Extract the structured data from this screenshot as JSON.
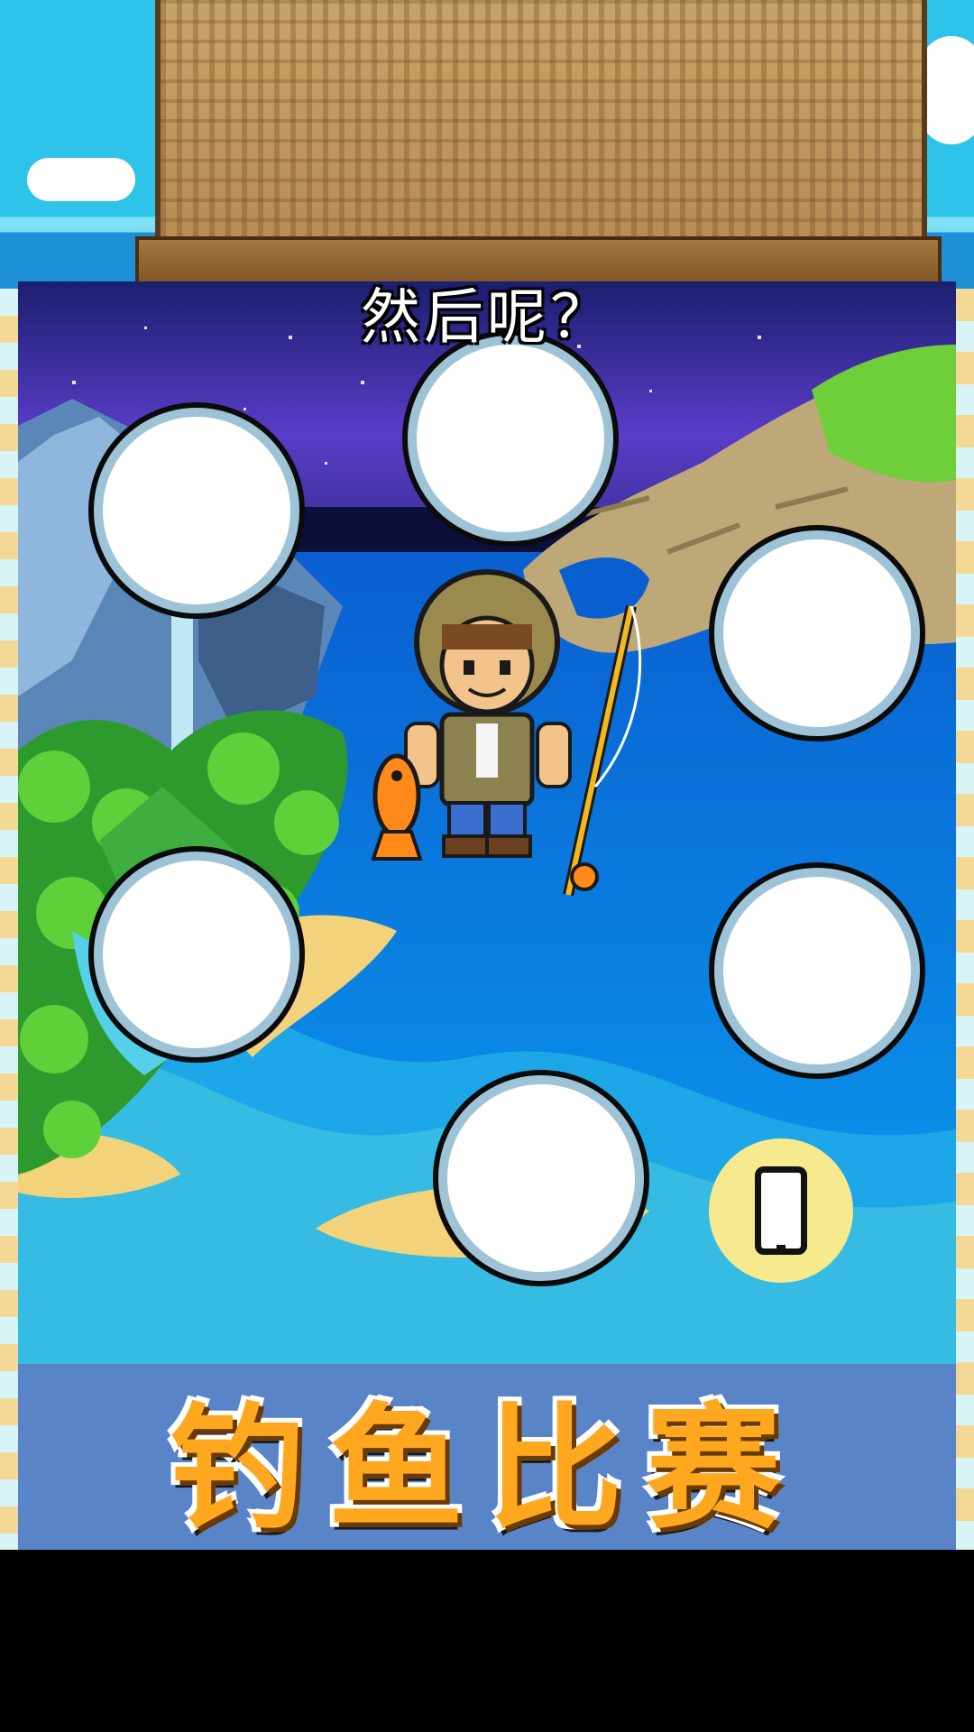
{
  "scene": {
    "prompt_text": "然后呢？",
    "slots_count": 6,
    "colors": {
      "sky_night": "#2c2a8c",
      "sea": "#0a7fe0",
      "sand": "#f2d27a",
      "slot_ring": "#9fc3d6",
      "phone_glow": "#f7ea8e"
    },
    "icons": [
      "phone-icon",
      "fisherman-character",
      "goldfish-icon",
      "fishing-rod-icon"
    ]
  },
  "banner": {
    "title": "钓鱼比赛",
    "color": "#ffa81f",
    "background": "#5a84c8"
  }
}
